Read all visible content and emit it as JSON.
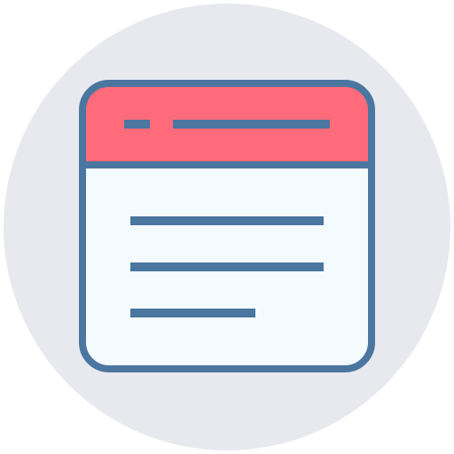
{
  "icon": {
    "name": "browser-window-icon",
    "colors": {
      "background_circle": "#E8E9EF",
      "outline": "#4A76A0",
      "header_fill": "#FF6B7A",
      "body_fill": "#F4FBFE"
    }
  }
}
